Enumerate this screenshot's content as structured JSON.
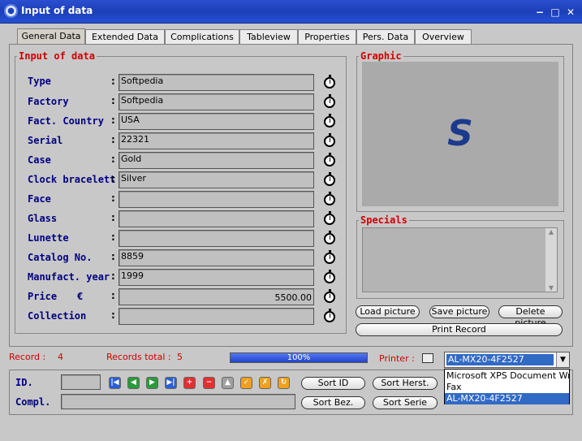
{
  "window": {
    "title": "Input of data",
    "minimize": "−",
    "maximize": "□",
    "close": "✕"
  },
  "tabs": [
    "General Data",
    "Extended Data",
    "Complications",
    "Tableview",
    "Properties",
    "Pers. Data",
    "Overview"
  ],
  "input_group": {
    "title": "Input of data",
    "fields": [
      {
        "label": "Type",
        "value": "Softpedia"
      },
      {
        "label": "Factory",
        "value": "Softpedia"
      },
      {
        "label": "Fact. Country",
        "value": "USA"
      },
      {
        "label": "Serial",
        "value": "22321"
      },
      {
        "label": "Case",
        "value": "Gold"
      },
      {
        "label": "Clock bracelett",
        "value": "Silver"
      },
      {
        "label": "Face",
        "value": ""
      },
      {
        "label": "Glass",
        "value": ""
      },
      {
        "label": "Lunette",
        "value": ""
      },
      {
        "label": "Catalog No.",
        "value": "8859"
      },
      {
        "label": "Manufact. year",
        "value": "1999"
      },
      {
        "label": "Price",
        "currency": "€",
        "value": "5500.00"
      },
      {
        "label": "Collection",
        "value": ""
      }
    ],
    "colon": ":"
  },
  "graphic": {
    "title": "Graphic",
    "logo": "S"
  },
  "specials": {
    "title": "Specials"
  },
  "picture_buttons": {
    "load": "Load picture",
    "save": "Save picture",
    "delete": "Delete picture",
    "print": "Print Record"
  },
  "status": {
    "record_label": "Record :",
    "record_value": "4",
    "total_label": "Records total :",
    "total_value": "5",
    "progress_label": "100%",
    "progress": 1.0,
    "printer_label": "Printer :"
  },
  "printer": {
    "selected": "AL-MX20-4F2527",
    "options": [
      "Microsoft XPS Document Writer",
      "Fax",
      "AL-MX20-4F2527"
    ]
  },
  "bottom": {
    "id_label": "ID.",
    "compl_label": "Compl.",
    "sort_id": "Sort ID",
    "sort_herst": "Sort Herst.",
    "sort_bez": "Sort Bez.",
    "sort_serie": "Sort Serie"
  },
  "nav_icons": [
    "first-record-icon",
    "previous-record-icon",
    "next-record-icon",
    "last-record-icon",
    "add-record-icon",
    "delete-record-icon",
    "edit-record-icon",
    "confirm-icon",
    "cancel-icon",
    "refresh-icon"
  ],
  "colors": {
    "label_blue": "#000080",
    "accent_red": "#d00000",
    "title_blue": "#1d3fb8"
  }
}
